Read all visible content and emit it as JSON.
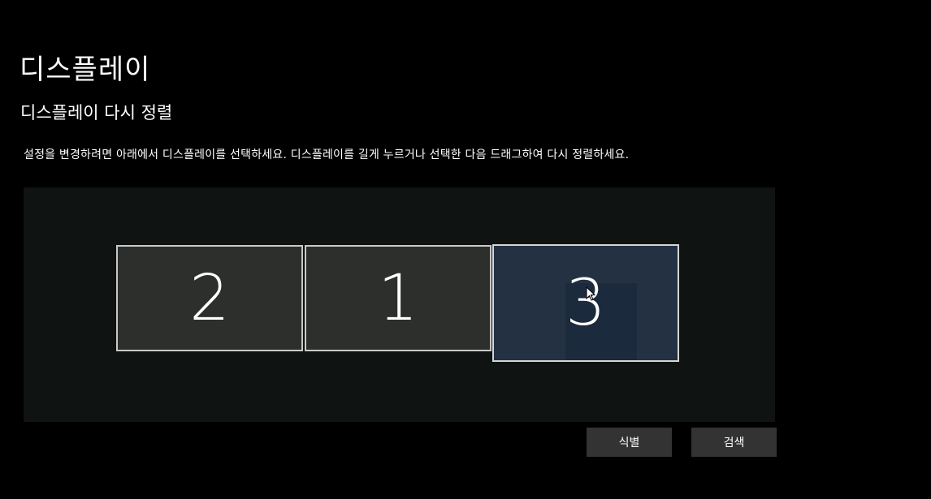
{
  "page": {
    "title": "디스플레이",
    "section_title": "디스플레이 다시 정렬",
    "description": "설정을 변경하려면 아래에서 디스플레이를 선택하세요. 디스플레이를 길게 누르거나 선택한 다음 드래그하여 다시 정렬하세요."
  },
  "monitors": [
    {
      "number": "2",
      "selected": false
    },
    {
      "number": "1",
      "selected": false
    },
    {
      "number": "3",
      "selected": true
    }
  ],
  "cursor": {
    "icon": "mouse-pointer-icon"
  },
  "buttons": {
    "identify_label": "식별",
    "detect_label": "검색"
  },
  "colors": {
    "background": "#000000",
    "arrange_area": "#0f1311",
    "monitor": "#2c2f2b",
    "monitor_selected": "#233143",
    "button": "#333333"
  }
}
